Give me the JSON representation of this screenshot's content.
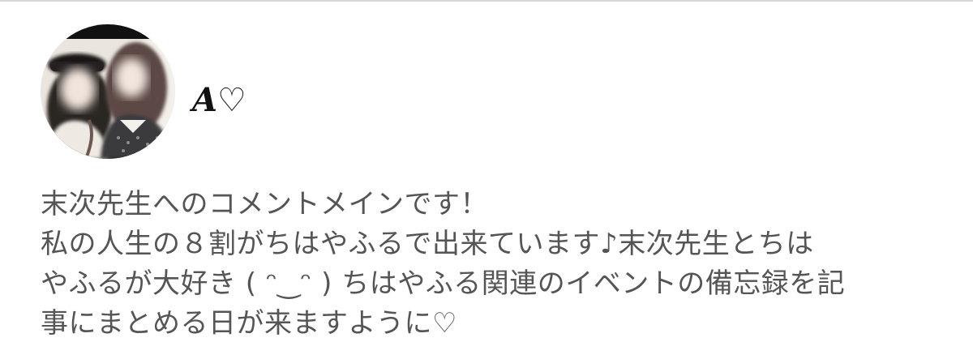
{
  "profile": {
    "display_name": "A♡",
    "bio": "末次先生へのコメントメインです！\n私の人生の８割がちはやふるで出来ています♪末次先生とちは\nやふるが大好き ( ᵔ‿ᵔ ) ちはやふる関連のイベントの備忘録を記\n事にまとめる日が来ますように♡"
  }
}
